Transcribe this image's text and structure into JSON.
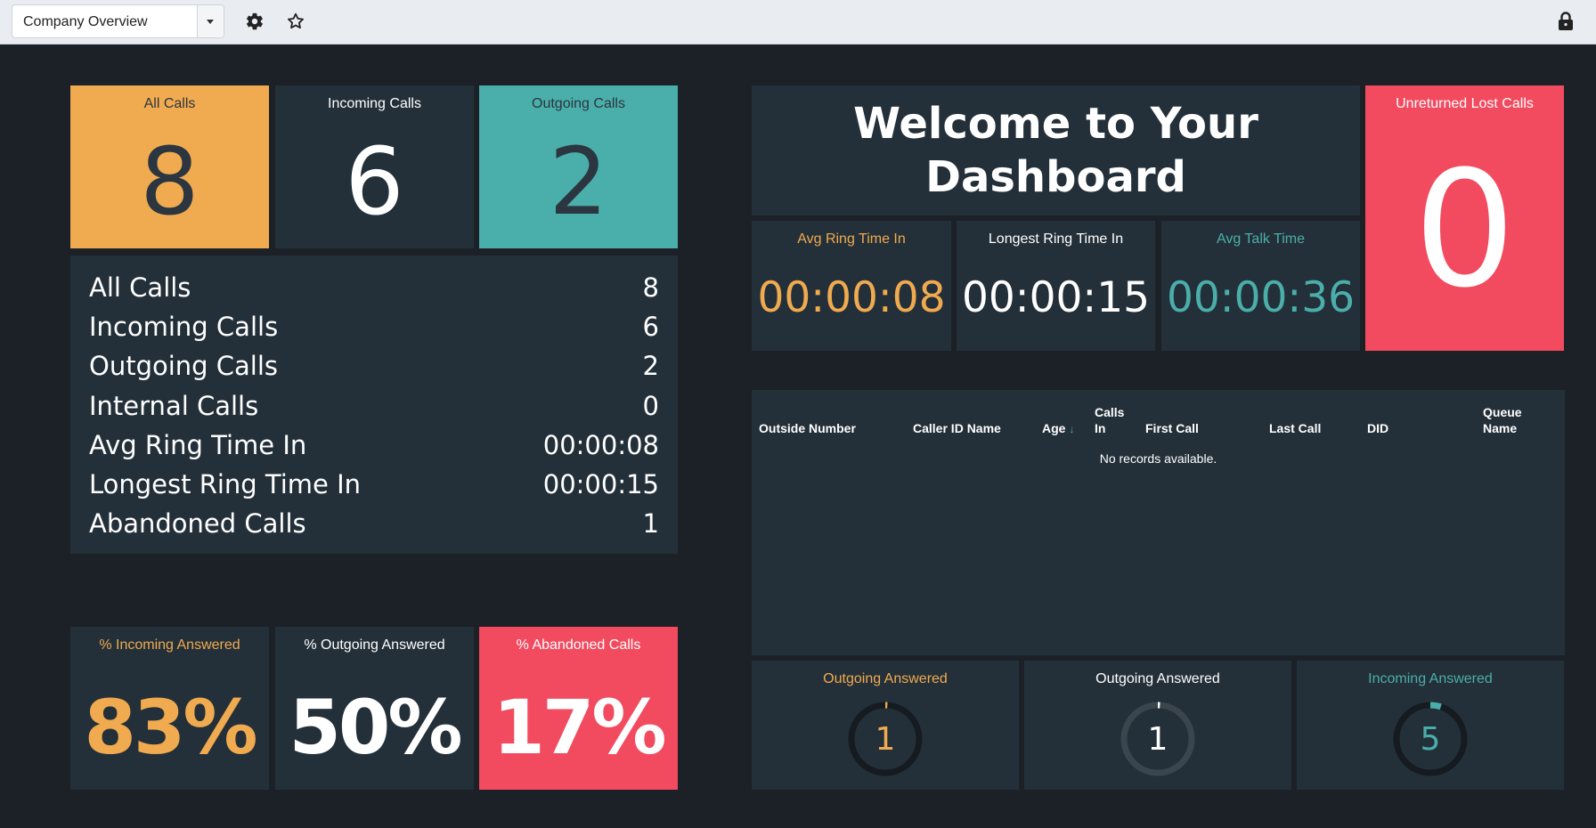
{
  "toolbar": {
    "dashboard_select": "Company Overview",
    "icons": [
      "gear-icon",
      "star-icon",
      "lock-icon"
    ]
  },
  "tiles": {
    "all_calls": {
      "label": "All Calls",
      "value": "8"
    },
    "incoming_calls": {
      "label": "Incoming Calls",
      "value": "6"
    },
    "outgoing_calls": {
      "label": "Outgoing Calls",
      "value": "2"
    },
    "unreturned_lost": {
      "label": "Unreturned Lost Calls",
      "value": "0"
    },
    "avg_ring": {
      "label": "Avg Ring Time In",
      "value": "00:00:08"
    },
    "longest_ring": {
      "label": "Longest Ring Time In",
      "value": "00:00:15"
    },
    "avg_talk": {
      "label": "Avg Talk Time",
      "value": "00:00:36"
    },
    "pct_incoming": {
      "label": "% Incoming Answered",
      "value": "83%"
    },
    "pct_outgoing": {
      "label": "% Outgoing Answered",
      "value": "50%"
    },
    "pct_abandoned": {
      "label": "% Abandoned Calls",
      "value": "17%"
    }
  },
  "welcome": {
    "line1": "Welcome to Your",
    "line2": "Dashboard"
  },
  "stats": [
    {
      "label": "All Calls",
      "value": "8"
    },
    {
      "label": "Incoming Calls",
      "value": "6"
    },
    {
      "label": "Outgoing Calls",
      "value": "2"
    },
    {
      "label": "Internal Calls",
      "value": "0"
    },
    {
      "label": "Avg Ring Time In",
      "value": "00:00:08"
    },
    {
      "label": "Longest Ring Time In",
      "value": "00:00:15"
    },
    {
      "label": "Abandoned Calls",
      "value": "1"
    }
  ],
  "table": {
    "columns": {
      "outside_number": "Outside Number",
      "caller_id_name": "Caller ID Name",
      "age": "Age",
      "calls_in_1": "Calls",
      "calls_in_2": "In",
      "first_call": "First Call",
      "last_call": "Last Call",
      "did": "DID",
      "queue_name_1": "Queue",
      "queue_name_2": "Name"
    },
    "sort_indicator": "↓",
    "empty_message": "No records available."
  },
  "gauges": {
    "outgoing_answered_1": {
      "label": "Outgoing Answered",
      "value": "1",
      "fraction": 0.01
    },
    "outgoing_answered_2": {
      "label": "Outgoing Answered",
      "value": "1",
      "fraction": 0.01
    },
    "incoming_answered": {
      "label": "Incoming Answered",
      "value": "5",
      "fraction": 0.05
    }
  },
  "colors": {
    "orange": "#f0aa4f",
    "teal": "#4aaeaa",
    "red": "#f24b5f",
    "panel": "#243039",
    "background": "#1b2127"
  }
}
